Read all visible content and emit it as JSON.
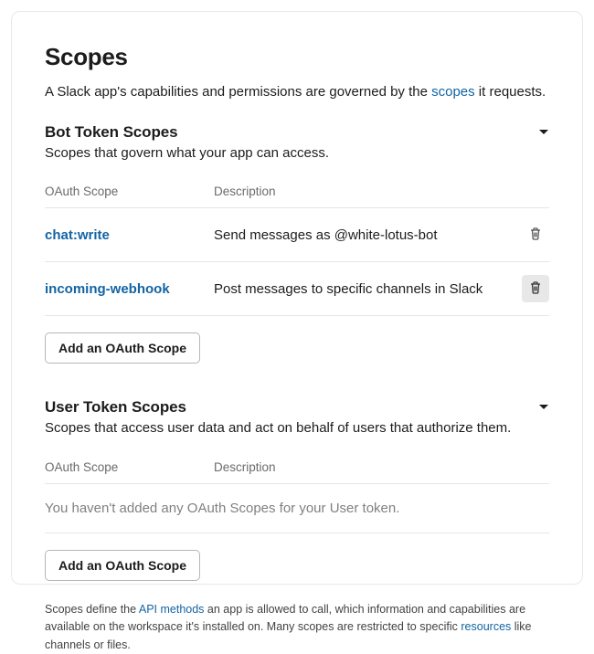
{
  "title": "Scopes",
  "intro_before": "A Slack app's capabilities and permissions are governed by the ",
  "intro_link": "scopes",
  "intro_after": " it requests.",
  "bot": {
    "title": "Bot Token Scopes",
    "subtitle": "Scopes that govern what your app can access.",
    "headers": {
      "scope": "OAuth Scope",
      "description": "Description"
    },
    "rows": [
      {
        "scope": "chat:write",
        "description": "Send messages as @white-lotus-bot"
      },
      {
        "scope": "incoming-webhook",
        "description": "Post messages to specific channels in Slack"
      }
    ],
    "add_label": "Add an OAuth Scope"
  },
  "user": {
    "title": "User Token Scopes",
    "subtitle": "Scopes that access user data and act on behalf of users that authorize them.",
    "headers": {
      "scope": "OAuth Scope",
      "description": "Description"
    },
    "empty": "You haven't added any OAuth Scopes for your User token.",
    "add_label": "Add an OAuth Scope"
  },
  "footnote": {
    "t1": "Scopes define the ",
    "link1": "API methods",
    "t2": " an app is allowed to call, which information and capabilities are available on the workspace it's installed on. Many scopes are restricted to specific ",
    "link2": "resources",
    "t3": " like channels or files."
  }
}
